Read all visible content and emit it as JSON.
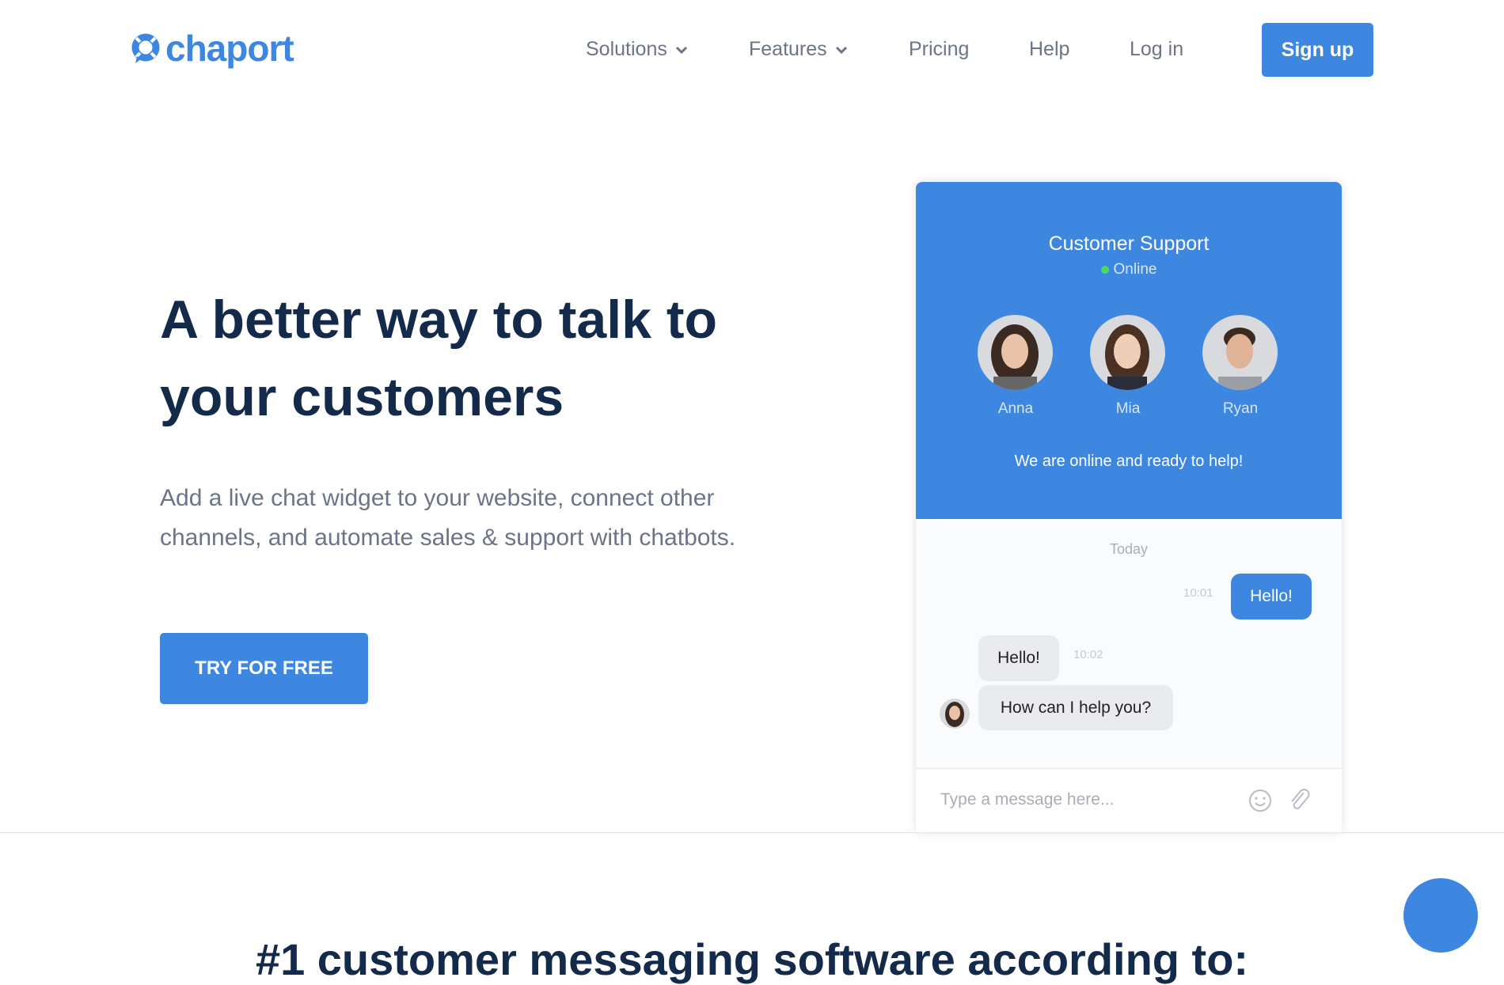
{
  "brand": {
    "name": "chaport",
    "accent": "#3d87e0",
    "dark": "#142a4a"
  },
  "nav": {
    "solutions": "Solutions",
    "features": "Features",
    "pricing": "Pricing",
    "help": "Help",
    "login": "Log in",
    "signup": "Sign up"
  },
  "hero": {
    "title": "A better way to talk to your customers",
    "subtitle": "Add a live chat widget to your website, connect other channels, and automate sales & support with chatbots.",
    "cta": "TRY FOR FREE"
  },
  "widget": {
    "title": "Customer Support",
    "status": "Online",
    "agents": [
      {
        "name": "Anna"
      },
      {
        "name": "Mia"
      },
      {
        "name": "Ryan"
      }
    ],
    "greeting": "We are online and ready to help!",
    "day": "Today",
    "messages": [
      {
        "from": "visitor",
        "text": "Hello!",
        "time": "10:01"
      },
      {
        "from": "agent",
        "text": "Hello!",
        "time": "10:02"
      },
      {
        "from": "agent",
        "text": "How can I help you?"
      }
    ],
    "input_placeholder": "Type a message here...",
    "icons": [
      "emoji-icon",
      "paperclip-icon"
    ]
  },
  "section": {
    "title": "#1 customer messaging software according to:"
  }
}
